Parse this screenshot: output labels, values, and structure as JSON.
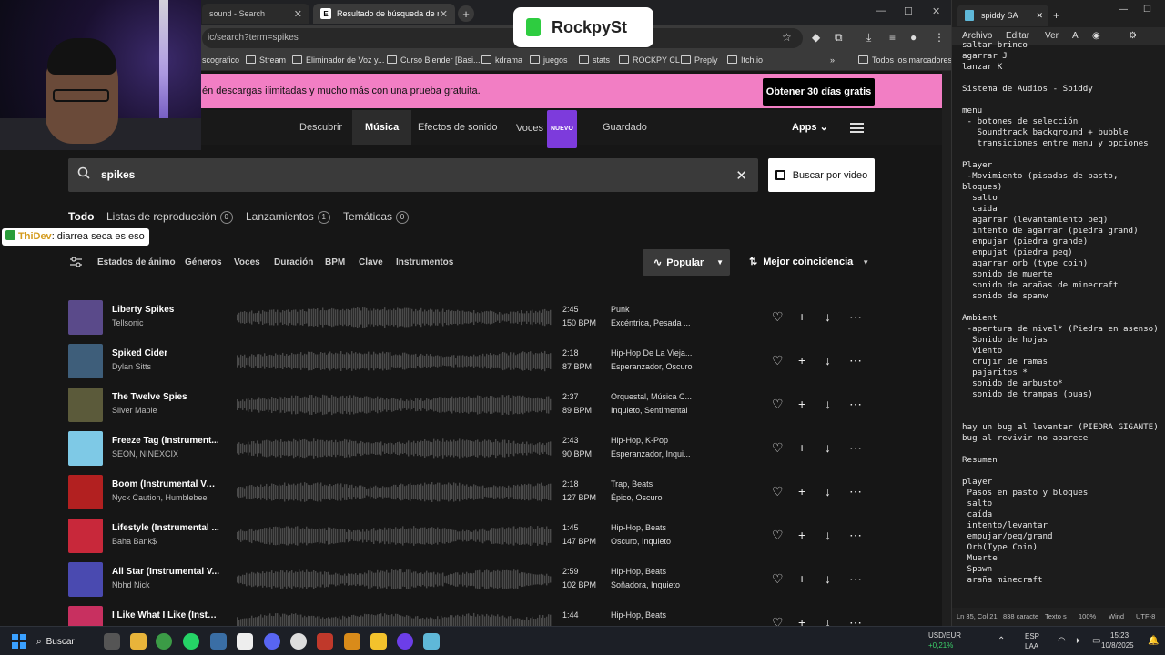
{
  "browser": {
    "tabs": [
      {
        "label": "sound - Search",
        "favicon": "b"
      },
      {
        "label": "Resultado de búsqueda de mú",
        "favicon": "E"
      }
    ],
    "url": "ic/search?term=spikes",
    "bookmarks": [
      "scografico",
      "Stream",
      "Eliminador de Voz y...",
      "Curso Blender [Basi...",
      "kdrama",
      "juegos",
      "stats",
      "ROCKPY CL",
      "Preply",
      "Itch.io",
      "Todos los marcadores"
    ],
    "bookmarks_more": "»"
  },
  "promo": {
    "text": "én descargas ilimitadas y mucho más con una prueba gratuita.",
    "button": "Obtener 30 días gratis"
  },
  "nav": {
    "items": [
      "Descubrir",
      "Música",
      "Efectos de sonido",
      "Voces",
      "Guardado"
    ],
    "nuevo_badge": "NUEVO",
    "apps": "Apps"
  },
  "search": {
    "value": "spikes",
    "video_button": "Buscar por video"
  },
  "result_tabs": [
    {
      "label": "Todo",
      "count": ""
    },
    {
      "label": "Listas de reproducción",
      "count": "0"
    },
    {
      "label": "Lanzamientos",
      "count": "1"
    },
    {
      "label": "Temáticas",
      "count": "0"
    }
  ],
  "filters": [
    "Estados de ánimo",
    "Géneros",
    "Voces",
    "Duración",
    "BPM",
    "Clave",
    "Instrumentos"
  ],
  "sort": {
    "popular": "Popular",
    "match": "Mejor coincidencia"
  },
  "tracks": [
    {
      "title": "Liberty Spikes",
      "artist": "Tellsonic",
      "duration": "2:45",
      "bpm": "150 BPM",
      "genre": "Punk",
      "mood": "Excéntrica, Pesada ...",
      "cover": "#5a4a8a",
      "progress": 0.0
    },
    {
      "title": "Spiked Cider",
      "artist": "Dylan Sitts",
      "duration": "2:18",
      "bpm": "87 BPM",
      "genre": "Hip-Hop De La Vieja...",
      "mood": "Esperanzador, Oscuro",
      "cover": "#3e5e7a",
      "progress": 0.0
    },
    {
      "title": "The Twelve Spies",
      "artist": "Silver Maple",
      "duration": "2:37",
      "bpm": "89 BPM",
      "genre": "Orquestal, Música C...",
      "mood": "Inquieto, Sentimental",
      "cover": "#5b5a3a",
      "progress": 0.0
    },
    {
      "title": "Freeze Tag (Instrument...",
      "artist": "SEON, NINEXCIX",
      "duration": "2:43",
      "bpm": "90 BPM",
      "genre": "Hip-Hop, K-Pop",
      "mood": "Esperanzador, Inqui...",
      "cover": "#7ec9e6",
      "progress": 0.0
    },
    {
      "title": "Boom (Instrumental Ver...",
      "artist": "Nyck Caution, Humblebee",
      "duration": "2:18",
      "bpm": "127 BPM",
      "genre": "Trap, Beats",
      "mood": "Épico, Oscuro",
      "cover": "#b22020",
      "progress": 0.0
    },
    {
      "title": "Lifestyle (Instrumental ...",
      "artist": "Baha Bank$",
      "duration": "1:45",
      "bpm": "147 BPM",
      "genre": "Hip-Hop, Beats",
      "mood": "Oscuro, Inquieto",
      "cover": "#c8283a",
      "progress": 0.0
    },
    {
      "title": "All Star (Instrumental V...",
      "artist": "Nbhd Nick",
      "duration": "2:59",
      "bpm": "102 BPM",
      "genre": "Hip-Hop, Beats",
      "mood": "Soñadora, Inquieto",
      "cover": "#4a4ab0",
      "progress": 0.0
    },
    {
      "title": "I Like What I Like (Instru...",
      "artist": "",
      "duration": "1:44",
      "bpm": "",
      "genre": "Hip-Hop, Beats",
      "mood": "",
      "cover": "#c83060",
      "progress": 0.0
    }
  ],
  "overlay": {
    "chat_user": "ThiDev",
    "chat_text": ": diarrea seca es eso",
    "badge": "RockpySt"
  },
  "notepad": {
    "tab_title": "spiddy SA",
    "menu": [
      "Archivo",
      "Editar",
      "Ver"
    ],
    "lines": [
      "saltar brinco",
      "agarrar J",
      "lanzar K",
      "",
      "Sistema de Audios - Spiddy",
      "",
      "menu",
      " - botones de selección",
      "   Soundtrack background + bubble",
      "   transiciones entre menu y opciones",
      "",
      "Player",
      " -Movimiento (pisadas de pasto,",
      "bloques)",
      "  salto",
      "  caida",
      "  agarrar (levantamiento peq)",
      "  intento de agarrar (piedra grand)",
      "  empujar (piedra grande)",
      "  empujat (piedra peq)",
      "  agarrar orb (type coin)",
      "  sonido de muerte",
      "  sonido de arañas de minecraft",
      "  sonido de spanw",
      "",
      "Ambient",
      " -apertura de nivel* (Piedra en asenso)",
      "  Sonido de hojas",
      "  Viento",
      "  crujir de ramas",
      "  pajaritos *",
      "  sonido de arbusto*",
      "  sonido de trampas (puas)",
      "",
      "",
      "hay un bug al levantar (PIEDRA GIGANTE)",
      "bug al revivir no aparece",
      "",
      "Resumen",
      "",
      "player",
      " Pasos en pasto y bloques",
      " salto",
      " caída",
      " intento/levantar",
      " empujar/peq/grand",
      " Orb(Type Coin)",
      " Muerte",
      " Spawn",
      " araña minecraft"
    ],
    "status": {
      "position": "Ln 35, Col 21",
      "chars": "838 caracte",
      "format": "Texto s",
      "zoom": "100%",
      "eol": "Wind",
      "encoding": "UTF-8"
    }
  },
  "taskbar": {
    "search": "Buscar",
    "currency": "USD/EUR",
    "currency_change": "+0,21%",
    "lang": "ESP",
    "lang2": "LAA",
    "time": "15:23",
    "date": "10/8/2025"
  }
}
